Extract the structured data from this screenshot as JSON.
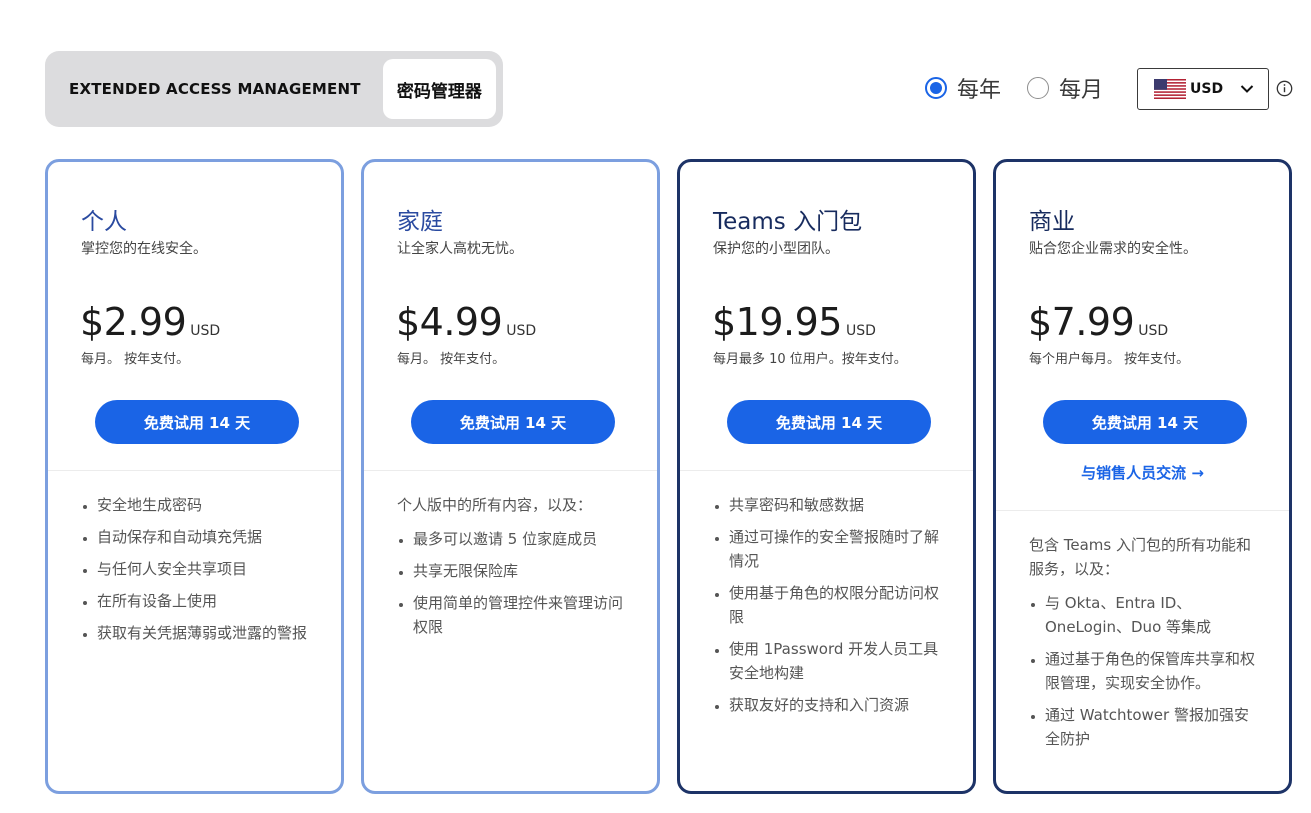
{
  "toggle": {
    "options": [
      "EXTENDED ACCESS MANAGEMENT",
      "密码管理器"
    ],
    "selected": "密码管理器"
  },
  "billing": {
    "yearly_label": "每年",
    "monthly_label": "每月",
    "selected": "每年"
  },
  "currency": {
    "code": "USD",
    "flag_icon": "us-flag-icon",
    "info_icon": "info-icon"
  },
  "colors": {
    "accent": "#1a64e6",
    "light_border": "#7c9fdf",
    "dark_border": "#1d3367"
  },
  "plans": [
    {
      "name": "个人",
      "description": "掌控您的在线安全。",
      "price": "$2.99",
      "currency": "USD",
      "price_note": "每月。 按年支付。",
      "cta": "免费试用 14 天",
      "features": [
        "安全地生成密码",
        "自动保存和自动填充凭据",
        "与任何人安全共享项目",
        "在所有设备上使用",
        "获取有关凭据薄弱或泄露的警报"
      ]
    },
    {
      "name": "家庭",
      "description": "让全家人高枕无忧。",
      "price": "$4.99",
      "currency": "USD",
      "price_note": "每月。 按年支付。",
      "cta": "免费试用 14 天",
      "intro": "个人版中的所有内容，以及：",
      "features": [
        "最多可以邀请 5 位家庭成员",
        "共享无限保险库",
        "使用简单的管理控件来管理访问权限"
      ]
    },
    {
      "name": "Teams 入门包",
      "description": "保护您的小型团队。",
      "price": "$19.95",
      "currency": "USD",
      "price_note": "每月最多 10 位用户。按年支付。",
      "cta": "免费试用 14 天",
      "features": [
        "共享密码和敏感数据",
        "通过可操作的安全警报随时了解情况",
        "使用基于角色的权限分配访问权限",
        "使用 1Password 开发人员工具安全地构建",
        "获取友好的支持和入门资源"
      ]
    },
    {
      "name": "商业",
      "description": "贴合您企业需求的安全性。",
      "price": "$7.99",
      "currency": "USD",
      "price_note": "每个用户每月。 按年支付。",
      "cta": "免费试用 14 天",
      "sales_link": "与销售人员交流 →",
      "intro": "包含 Teams 入门包的所有功能和服务，以及：",
      "features": [
        "与 Okta、Entra ID、OneLogin、Duo 等集成",
        "通过基于角色的保管库共享和权限管理，实现安全协作。",
        "通过 Watchtower 警报加强安全防护"
      ]
    }
  ]
}
